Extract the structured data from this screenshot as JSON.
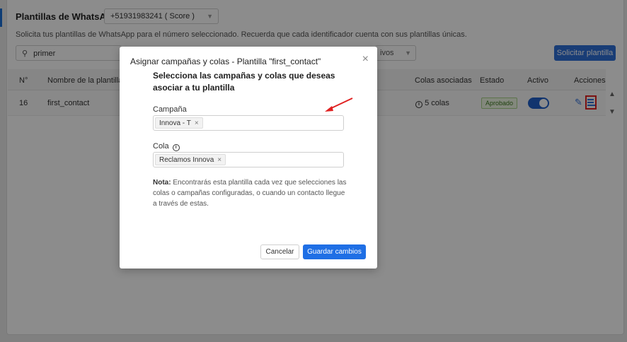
{
  "header": {
    "title": "Plantillas de WhatsApp",
    "number_selected": "+51931983241 ( Score )",
    "description": "Solicita tus plantillas de WhatsApp para el número seleccionado. Recuerda que cada identificador cuenta con sus plantillas únicas."
  },
  "toolbar": {
    "search_value": "primer",
    "filter_value": "ivos",
    "request_label": "Solicitar plantilla"
  },
  "table": {
    "columns": [
      "N°",
      "Nombre de la plantilla",
      "Colas asociadas",
      "Estado",
      "Activo",
      "Acciones"
    ],
    "rows": [
      {
        "num": "16",
        "name": "first_contact",
        "queues": "5 colas",
        "status": "Aprobado",
        "active": true
      }
    ]
  },
  "modal": {
    "title": "Asignar campañas y colas - Plantilla \"first_contact\"",
    "close": "×",
    "subtitle": "Selecciona las campañas y colas que deseas asociar a tu plantilla",
    "campaign_label": "Campaña",
    "campaign_tags": [
      "Innova - T"
    ],
    "queue_label": "Cola",
    "queue_tags": [
      "Reclamos Innova"
    ],
    "note_bold": "Nota:",
    "note_text": "Encontrarás esta plantilla cada vez que selecciones las colas o campañas configuradas, o cuando un contacto llegue a través de estas.",
    "cancel_label": "Cancelar",
    "save_label": "Guardar cambios"
  },
  "colors": {
    "primary": "#1f6fe5",
    "annotation": "#e02020",
    "approved": "#3d7a20"
  }
}
